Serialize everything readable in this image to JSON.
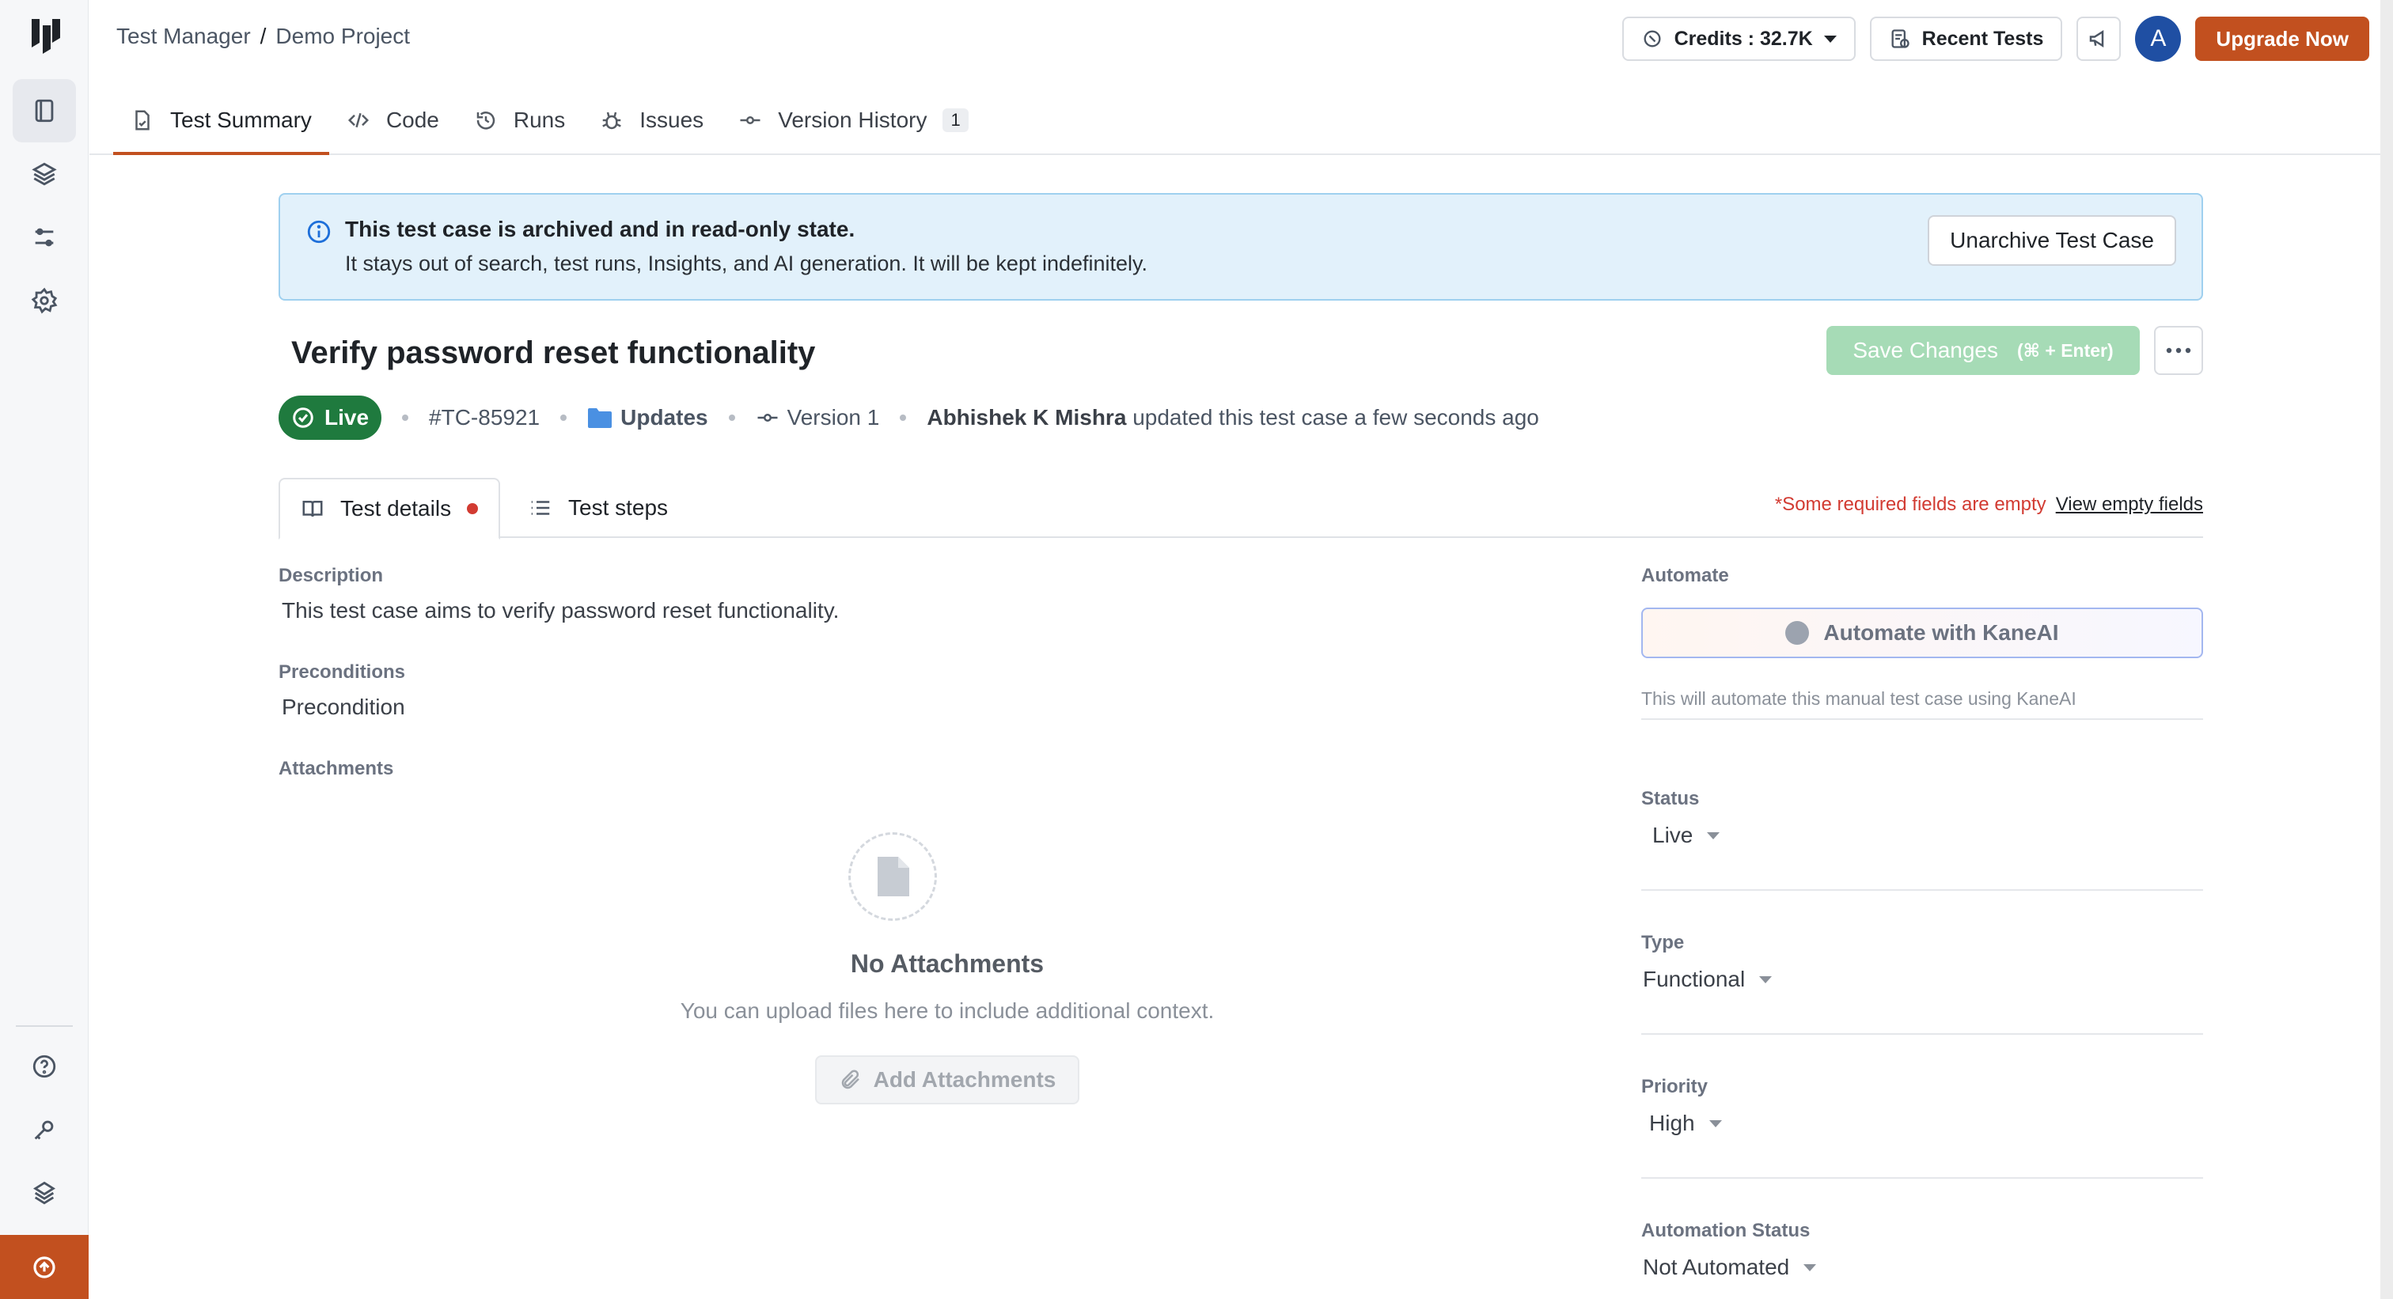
{
  "colors": {
    "accent": "#c2501f",
    "live": "#1f7a3e",
    "banner_bg": "#e2f1fb",
    "save_disabled": "#a6dbb6",
    "error": "#d23b32"
  },
  "sidebar": {
    "logo": "lambdatest-logo",
    "items": [
      {
        "name": "test-manager",
        "icon": "book-icon",
        "active": true
      },
      {
        "name": "layers",
        "icon": "layers-icon",
        "active": false
      },
      {
        "name": "filters",
        "icon": "sliders-icon",
        "active": false
      },
      {
        "name": "settings",
        "icon": "gear-icon",
        "active": false
      }
    ],
    "bottom_items": [
      {
        "name": "help",
        "icon": "help-icon"
      },
      {
        "name": "keys",
        "icon": "key-icon"
      },
      {
        "name": "integrations",
        "icon": "layers-alt-icon"
      }
    ],
    "footer_icon": "arrow-up-circle-icon"
  },
  "header": {
    "breadcrumb": [
      "Test Manager",
      "Demo Project"
    ],
    "credits_label": "Credits : 32.7K",
    "recent_tests_label": "Recent Tests",
    "avatar_initial": "A",
    "upgrade_label": "Upgrade Now"
  },
  "tabs": [
    {
      "label": "Test Summary",
      "icon": "file-check-icon",
      "active": true
    },
    {
      "label": "Code",
      "icon": "code-icon"
    },
    {
      "label": "Runs",
      "icon": "history-icon"
    },
    {
      "label": "Issues",
      "icon": "bug-icon"
    },
    {
      "label": "Version History",
      "icon": "commit-icon",
      "count": "1"
    }
  ],
  "banner": {
    "title": "This test case is archived and in read-only state.",
    "description": "It stays out of search, test runs, Insights, and AI generation. It will be kept indefinitely.",
    "action_label": "Unarchive Test Case"
  },
  "test_case": {
    "title": "Verify password reset functionality",
    "save_label": "Save Changes",
    "save_shortcut": "(⌘ + Enter)",
    "status_badge": "Live",
    "id": "#TC-85921",
    "folder": "Updates",
    "version": "Version 1",
    "updated_by": "Abhishek K Mishra",
    "updated_text": "updated this test case a few seconds ago"
  },
  "subtabs": [
    {
      "label": "Test details",
      "active": true,
      "has_error": true
    },
    {
      "label": "Test steps",
      "active": false
    }
  ],
  "required_note": {
    "warning": "*Some required fields are empty",
    "link": "View empty fields"
  },
  "details": {
    "description_label": "Description",
    "description_value": "This test case aims to verify password reset functionality.",
    "preconditions_label": "Preconditions",
    "preconditions_value": "Precondition",
    "attachments_label": "Attachments",
    "no_attachments_title": "No Attachments",
    "no_attachments_desc": "You can upload files here to include additional context.",
    "add_attachments_label": "Add Attachments"
  },
  "right_panel": {
    "automate_label": "Automate",
    "automate_button": "Automate with KaneAI",
    "automate_note": "This will automate this manual test case using KaneAI",
    "status_label": "Status",
    "status_value": "Live",
    "type_label": "Type",
    "type_value": "Functional",
    "priority_label": "Priority",
    "priority_value": "High",
    "automation_status_label": "Automation Status",
    "automation_status_value": "Not Automated"
  }
}
